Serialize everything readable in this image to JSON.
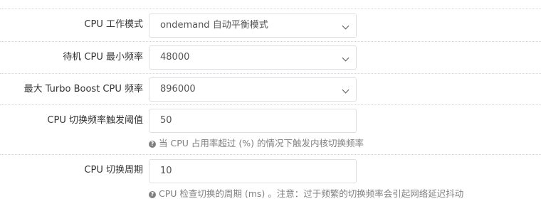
{
  "form": {
    "rows": [
      {
        "label": "CPU 工作模式",
        "type": "select",
        "value": "ondemand 自动平衡模式"
      },
      {
        "label": "待机 CPU 最小频率",
        "type": "select",
        "value": "48000"
      },
      {
        "label": "最大 Turbo Boost CPU 频率",
        "type": "select",
        "value": "896000"
      },
      {
        "label": "CPU 切换频率触发阈值",
        "type": "input",
        "value": "50",
        "help_text": "当 CPU 占用率超过 (%) 的情况下触发内核切换频率"
      },
      {
        "label": "CPU 切换周期",
        "type": "input",
        "value": "10",
        "help_text": "CPU 检查切换的周期 (ms) 。注意：过于频繁的切换频率会引起网络延迟抖动"
      }
    ],
    "help_icon": "question-circle-icon"
  }
}
